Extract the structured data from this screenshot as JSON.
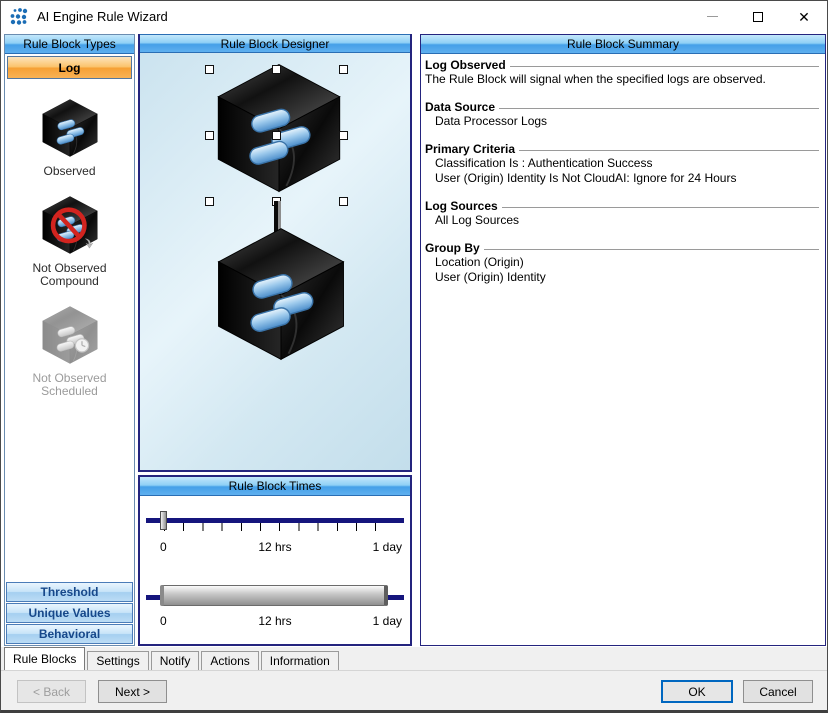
{
  "window": {
    "title": "AI Engine Rule Wizard",
    "controls": [
      "minimize",
      "maximize",
      "close"
    ]
  },
  "left_panel": {
    "header": "Rule Block Types",
    "log_button": "Log",
    "items": [
      {
        "label": "Observed",
        "icon": "cube-observed-icon",
        "disabled": false
      },
      {
        "label": "Not Observed Compound",
        "icon": "cube-not-observed-icon",
        "disabled": false
      },
      {
        "label": "Not Observed Scheduled",
        "icon": "cube-scheduled-icon",
        "disabled": true
      }
    ],
    "bottom_buttons": [
      "Threshold",
      "Unique Values",
      "Behavioral"
    ]
  },
  "designer": {
    "header": "Rule Block Designer",
    "blocks": [
      "log-observed-block-selected",
      "log-observed-block"
    ]
  },
  "times": {
    "header": "Rule Block Times",
    "slider1": {
      "labels": [
        "0",
        "12 hrs",
        "1 day"
      ],
      "thumb_position": "0"
    },
    "slider2": {
      "labels": [
        "0",
        "12 hrs",
        "1 day"
      ],
      "range": [
        "0",
        "1 day"
      ]
    }
  },
  "summary": {
    "header": "Rule Block Summary",
    "sections": [
      {
        "heading": "Log Observed",
        "lines": [
          "The Rule Block will signal when the specified logs are observed."
        ],
        "indent": false
      },
      {
        "heading": "Data Source",
        "lines": [
          "Data Processor Logs"
        ],
        "indent": true
      },
      {
        "heading": "Primary Criteria",
        "lines": [
          "Classification Is : Authentication Success",
          "User (Origin) Identity Is Not CloudAI: Ignore for 24 Hours"
        ],
        "indent": true
      },
      {
        "heading": "Log Sources",
        "lines": [
          "All Log Sources"
        ],
        "indent": true
      },
      {
        "heading": "Group By",
        "lines": [
          "Location (Origin)",
          "User (Origin) Identity"
        ],
        "indent": true
      }
    ]
  },
  "tabs": [
    {
      "label": "Rule Blocks",
      "active": true
    },
    {
      "label": "Settings",
      "active": false
    },
    {
      "label": "Notify",
      "active": false
    },
    {
      "label": "Actions",
      "active": false
    },
    {
      "label": "Information",
      "active": false
    }
  ],
  "footer": {
    "back": "< Back",
    "next": "Next >",
    "ok": "OK",
    "cancel": "Cancel"
  },
  "colors": {
    "header_blue": "#45a0e8",
    "log_orange": "#f6a034",
    "navy_border": "#24247e",
    "track_navy": "#15157d",
    "category_text": "#17488a",
    "ok_focus": "#0067c0"
  }
}
